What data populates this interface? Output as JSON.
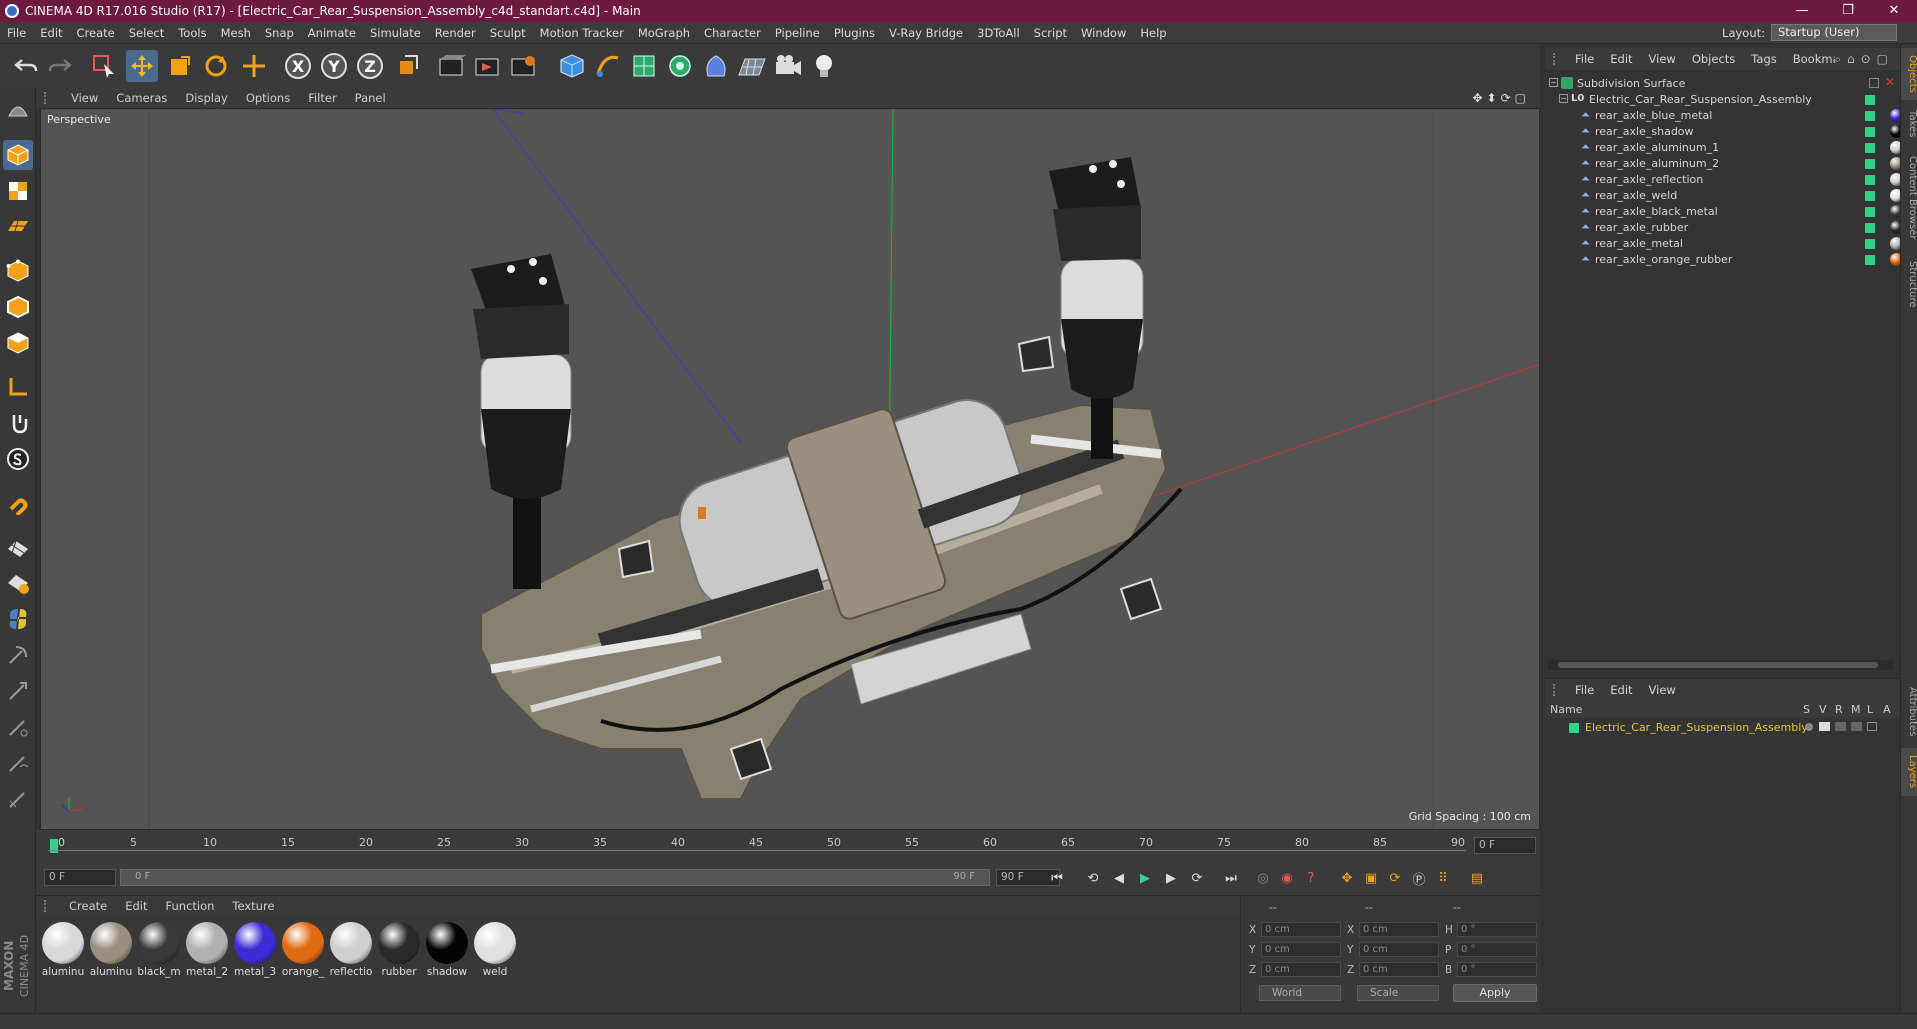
{
  "window": {
    "title": "CINEMA 4D R17.016 Studio (R17) - [Electric_Car_Rear_Suspension_Assembly_c4d_standart.c4d] - Main",
    "minimize": "—",
    "maximize": "❐",
    "close": "✕"
  },
  "menu": [
    "File",
    "Edit",
    "Create",
    "Select",
    "Tools",
    "Mesh",
    "Snap",
    "Animate",
    "Simulate",
    "Render",
    "Sculpt",
    "Motion Tracker",
    "MoGraph",
    "Character",
    "Pipeline",
    "Plugins",
    "V-Ray Bridge",
    "3DToAll",
    "Script",
    "Window",
    "Help"
  ],
  "layout": {
    "label": "Layout:",
    "value": "Startup (User)"
  },
  "toolbar": {
    "x": "X",
    "y": "Y",
    "z": "Z"
  },
  "viewport": {
    "menu": [
      "View",
      "Cameras",
      "Display",
      "Options",
      "Filter",
      "Panel"
    ],
    "label": "Perspective",
    "grid_spacing": "Grid Spacing : 100 cm"
  },
  "timeline": {
    "ticks": [
      "0",
      "5",
      "10",
      "15",
      "20",
      "25",
      "30",
      "35",
      "40",
      "45",
      "50",
      "55",
      "60",
      "65",
      "70",
      "75",
      "80",
      "85",
      "90"
    ],
    "current_frame": "0 F",
    "start": "0 F",
    "range_start": "0 F",
    "range_end": "90 F",
    "end": "90 F"
  },
  "materials": {
    "menu": [
      "Create",
      "Edit",
      "Function",
      "Texture"
    ],
    "items": [
      {
        "name": "aluminu",
        "color": "#d9d9d9"
      },
      {
        "name": "aluminu",
        "color": "#9b9080"
      },
      {
        "name": "black_m",
        "color": "#3a3a3a"
      },
      {
        "name": "metal_2",
        "color": "#b0b0b0"
      },
      {
        "name": "metal_3",
        "color": "#3b2ad6"
      },
      {
        "name": "orange_",
        "color": "#e06a10"
      },
      {
        "name": "reflectio",
        "color": "#cfcfcf"
      },
      {
        "name": "rubber",
        "color": "#2a2a2a"
      },
      {
        "name": "shadow",
        "color": "#050505"
      },
      {
        "name": "weld",
        "color": "#e0e0e0"
      }
    ]
  },
  "coords": {
    "header": [
      "--",
      "--",
      "--"
    ],
    "rows": [
      {
        "l1": "X",
        "v1": "0 cm",
        "l2": "X",
        "v2": "0 cm",
        "l3": "H",
        "v3": "0 °"
      },
      {
        "l1": "Y",
        "v1": "0 cm",
        "l2": "Y",
        "v2": "0 cm",
        "l3": "P",
        "v3": "0 °"
      },
      {
        "l1": "Z",
        "v1": "0 cm",
        "l2": "Z",
        "v2": "0 cm",
        "l3": "B",
        "v3": "0 °"
      }
    ],
    "world": "World",
    "scale": "Scale",
    "apply": "Apply"
  },
  "maxon": {
    "line1": "MAXON",
    "line2": "CINEMA 4D"
  },
  "objects": {
    "menu": [
      "File",
      "Edit",
      "View",
      "Objects",
      "Tags",
      "Bookmarks"
    ],
    "root": "Subdivision Surface",
    "group": "Electric_Car_Rear_Suspension_Assembly",
    "group_icon": "L0",
    "children": [
      {
        "name": "rear_axle_blue_metal",
        "tag_color": "#3b2ad6"
      },
      {
        "name": "rear_axle_shadow",
        "tag_color": "#050505"
      },
      {
        "name": "rear_axle_aluminum_1",
        "tag_color": "#d0d0d0"
      },
      {
        "name": "rear_axle_aluminum_2",
        "tag_color": "#9b9080"
      },
      {
        "name": "rear_axle_reflection",
        "tag_color": "#cfcfcf"
      },
      {
        "name": "rear_axle_weld",
        "tag_color": "#e0e0e0"
      },
      {
        "name": "rear_axle_black_metal",
        "tag_color": "#3a3a3a"
      },
      {
        "name": "rear_axle_rubber",
        "tag_color": "#2a2a2a"
      },
      {
        "name": "rear_axle_metal",
        "tag_color": "#b0b0b0"
      },
      {
        "name": "rear_axle_orange_rubber",
        "tag_color": "#e06a10"
      }
    ]
  },
  "layers": {
    "menu": [
      "File",
      "Edit",
      "View"
    ],
    "columns": [
      "Name",
      "S",
      "V",
      "R",
      "M",
      "L",
      "A"
    ],
    "rows": [
      {
        "name": "Electric_Car_Rear_Suspension_Assembly"
      }
    ]
  },
  "right_tabs": [
    "Objects",
    "Takes",
    "Content Browser",
    "Structure",
    "Attributes",
    "Layers"
  ],
  "colors": {
    "title_bar": "#6e1a3e",
    "accent_green": "#2fd38a",
    "layer_name": "#e3c23a"
  }
}
